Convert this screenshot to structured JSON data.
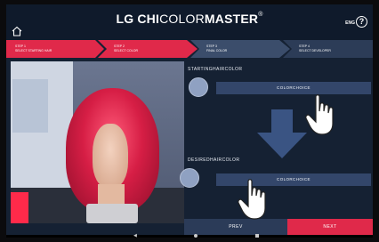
{
  "header": {
    "logo_lg": "LG",
    "logo_chi": " CHI",
    "logo_color": "COLOR",
    "logo_master": "MASTER",
    "logo_reg": "®",
    "language": "ENG",
    "help_symbol": "?"
  },
  "steps": [
    {
      "title": "STEP 1",
      "subtitle": "SELECT STARTING HAIR"
    },
    {
      "title": "STEP 2",
      "subtitle": "SELECT COLOR"
    },
    {
      "title": "STEP 3",
      "subtitle": "FINAL COLOR"
    },
    {
      "title": "STEP 4",
      "subtitle": "SELECT DEVELOPER"
    }
  ],
  "starting": {
    "label": "STARTINGHAIRCOLOR",
    "button": "COLORCHOICE"
  },
  "desired": {
    "label": "DESIREDHAIRCOLOR",
    "button": "COLORCHOICE"
  },
  "footer": {
    "prev": "PREV",
    "next": "NEXT"
  },
  "nav": {
    "back": "◀"
  },
  "colors": {
    "accent": "#e0294a",
    "panel": "#152133",
    "button": "#33466a",
    "swatch": "#8fa1c2"
  },
  "icons": [
    "home-icon",
    "help-icon",
    "down-arrow-icon",
    "pointing-hand-icon"
  ]
}
